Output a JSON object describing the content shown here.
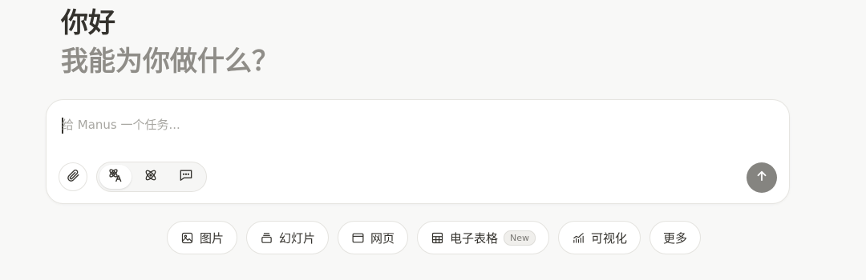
{
  "hero": {
    "greeting": "你好",
    "subtitle": "我能为你做什么？"
  },
  "composer": {
    "placeholder": "给 Manus 一个任务...",
    "value": "",
    "attach_icon": "paperclip-icon",
    "modes": [
      {
        "icon": "agent-mode-icon",
        "active": true
      },
      {
        "icon": "atom-icon",
        "active": false
      },
      {
        "icon": "chat-icon",
        "active": false
      }
    ],
    "send_icon": "arrow-up-icon"
  },
  "chips": [
    {
      "icon": "image-icon",
      "label": "图片"
    },
    {
      "icon": "slides-icon",
      "label": "幻灯片"
    },
    {
      "icon": "browser-window-icon",
      "label": "网页"
    },
    {
      "icon": "table-icon",
      "label": "电子表格",
      "badge": "New"
    },
    {
      "icon": "chart-icon",
      "label": "可视化"
    },
    {
      "icon": "",
      "label": "更多"
    }
  ],
  "colors": {
    "background": "#f8f8f7",
    "text": "#34322d",
    "muted_text": "#8f8d88",
    "send_button": "#858480"
  }
}
